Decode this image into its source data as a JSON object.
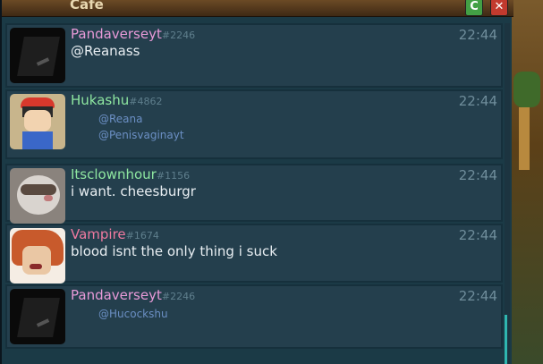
{
  "window": {
    "title": "Cafe"
  },
  "buttons": {
    "refresh": "C",
    "close": "✕"
  },
  "messages": [
    {
      "user": "Pandaverseyt",
      "tag": "#2246",
      "time": "22:44",
      "text": "@Reanass",
      "mentions": [],
      "name_color": "#e89ad8",
      "avatar": "dark-avatar"
    },
    {
      "user": "Hukashu",
      "tag": "#4862",
      "time": "22:44",
      "text": "",
      "mentions": [
        "@Reana",
        "@Penisvaginayt"
      ],
      "name_color": "#8ee6a0",
      "avatar": "boy-avatar"
    },
    {
      "user": "Itsclownhour",
      "tag": "#1156",
      "time": "22:44",
      "text": "i want. cheesburgr",
      "mentions": [],
      "name_color": "#8ee6a0",
      "avatar": "ferret-avatar"
    },
    {
      "user": "Vampire",
      "tag": "#1674",
      "time": "22:44",
      "text": "blood isnt the only thing i suck",
      "mentions": [],
      "name_color": "#f07aa0",
      "avatar": "vampire-avatar"
    },
    {
      "user": "Pandaverseyt",
      "tag": "#2246",
      "time": "22:44",
      "text": "",
      "mentions": [
        "@Hucockshu"
      ],
      "name_color": "#e89ad8",
      "avatar": "dark-avatar"
    }
  ]
}
